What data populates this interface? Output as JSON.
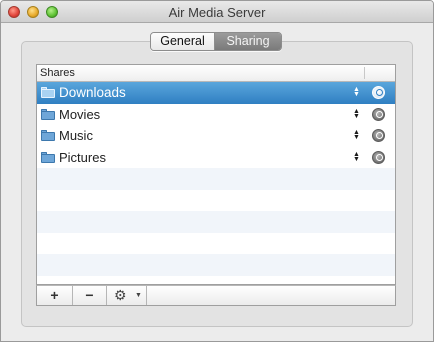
{
  "window": {
    "title": "Air Media Server"
  },
  "tabs": [
    {
      "label": "General",
      "selected": false
    },
    {
      "label": "Sharing",
      "selected": true
    }
  ],
  "table": {
    "column_header": "Shares",
    "rows": [
      {
        "label": "Downloads",
        "icon": "folder-icon",
        "selected": true
      },
      {
        "label": "Movies",
        "icon": "folder-icon",
        "selected": false
      },
      {
        "label": "Music",
        "icon": "folder-icon",
        "selected": false
      },
      {
        "label": "Pictures",
        "icon": "folder-icon",
        "selected": false
      }
    ]
  },
  "toolbar": {
    "add_label": "+",
    "remove_label": "−",
    "action_icon": "gear-icon"
  },
  "colors": {
    "selection": "#3a8fd0",
    "folder": "#6ea6d8"
  }
}
